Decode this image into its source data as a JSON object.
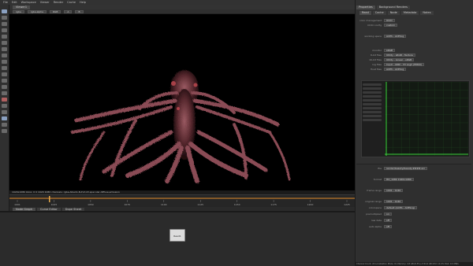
{
  "menubar": {
    "items": [
      "File",
      "Edit",
      "Workspace",
      "Viewer",
      "Render",
      "Cache",
      "Help"
    ]
  },
  "viewer": {
    "tab_label": "Viewer1",
    "controls": {
      "channels": "rgba",
      "colorspace": "rgba.alpha",
      "mode": "RGB",
      "input_a": "A",
      "input_b": "B"
    },
    "status_text": "1920x1080 bbox: 0 0 1920 1080 channels: rgba,Albedo,N,P,Z,UV,specular,diffuse,emission",
    "frame_current": "1001",
    "frame_end": "1240",
    "fps": "24 fps",
    "timeline_labels": [
      "1001",
      "1025",
      "1050",
      "1075",
      "1100",
      "1125",
      "1150",
      "1175",
      "1200",
      "1225"
    ],
    "accent_color": "#e08a2a",
    "playhead_color": "#e6a94a"
  },
  "nodegraph": {
    "tabs": [
      "Node Graph",
      "Curve Editor",
      "Dope Sheet"
    ],
    "node_label": "Read1"
  },
  "properties": {
    "title": "Properties",
    "secondary": "Background Renders",
    "tabs": [
      "Read",
      "Cache",
      "Node",
      "Metadata",
      "Notes"
    ],
    "rows": [
      {
        "label": "color management",
        "value": "OCIO"
      },
      {
        "label": "OCIO config",
        "value": "custom"
      },
      {
        "label": "working space",
        "value": "ACES - ACEScg"
      },
      {
        "label": "monitor",
        "value": "sRGB"
      },
      {
        "label": "8-bit files",
        "value": "Utility - sRGB - Texture"
      },
      {
        "label": "16-bit files",
        "value": "Utility - Linear - sRGB"
      },
      {
        "label": "log files",
        "value": "Input - ARRI - V3 LogC (EI800)"
      },
      {
        "label": "float files",
        "value": "ACES - ACEScg"
      }
    ],
    "lower_rows": [
      {
        "label": "file",
        "value": "render/beauty/beauty.####.exr"
      },
      {
        "label": "format",
        "value": "HD_1080 1920x1080"
      },
      {
        "label": "frame range",
        "value": "1001 - 1240"
      },
      {
        "label": "original range",
        "value": "1001 - 1240"
      },
      {
        "label": "colorspace",
        "value": "default (ACES - ACEScg)"
      },
      {
        "label": "premultiplied",
        "value": "on"
      },
      {
        "label": "raw data",
        "value": "off"
      },
      {
        "label": "auto alpha",
        "value": "off"
      }
    ],
    "graph_color": "#3cd13c"
  },
  "statusbar": {
    "text": "Channel Count: 24 Localization Mode: On Memory: 4.8 GB (8.5%) of 64.0 GB CPU: 12.0% Disk: 0.0 MB/s"
  }
}
